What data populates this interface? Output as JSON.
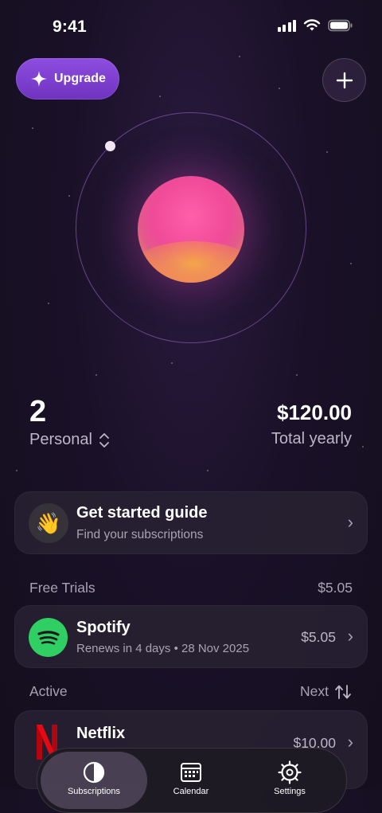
{
  "status_bar": {
    "time": "9:41"
  },
  "header": {
    "upgrade_label": "Upgrade"
  },
  "summary": {
    "count": "2",
    "account": "Personal",
    "total": "$120.00",
    "total_label": "Total yearly"
  },
  "guide": {
    "title": "Get started guide",
    "subtitle": "Find your subscriptions",
    "icon": "👋"
  },
  "free_trials": {
    "heading": "Free Trials",
    "amount": "$5.05",
    "items": [
      {
        "name": "Spotify",
        "renewal": "Renews in 4 days • 28 Nov 2025",
        "price": "$5.05"
      }
    ]
  },
  "active": {
    "heading": "Active",
    "sort_label": "Next",
    "items": [
      {
        "name": "Netflix",
        "price": "$10.00"
      }
    ]
  },
  "tabs": [
    {
      "label": "Subscriptions",
      "icon": "circle-half-icon"
    },
    {
      "label": "Calendar",
      "icon": "calendar-icon"
    },
    {
      "label": "Settings",
      "icon": "gear-icon"
    }
  ],
  "colors": {
    "accent": "#7b3fd0",
    "planet": "#f04a9a",
    "spotify": "#2fcf64",
    "netflix": "#e50914"
  }
}
